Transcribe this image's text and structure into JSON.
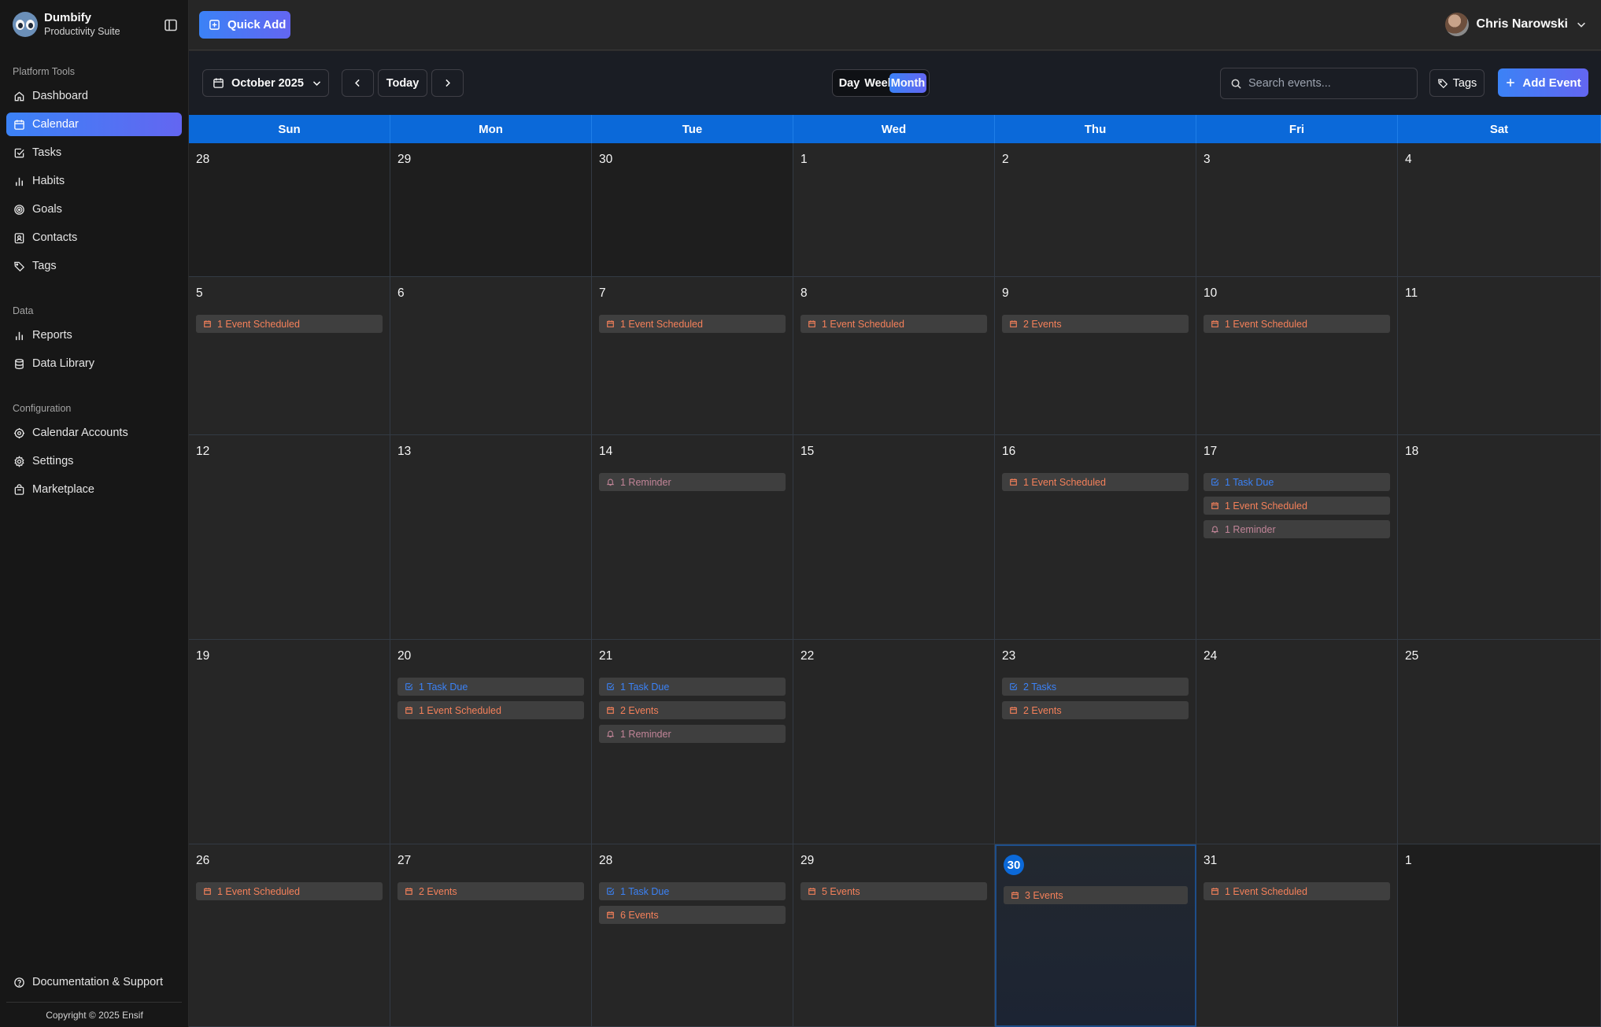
{
  "app": {
    "name": "Dumbify",
    "subtitle": "Productivity Suite"
  },
  "sidebar": {
    "sections": [
      {
        "title": "Platform Tools",
        "items": [
          {
            "label": "Dashboard",
            "icon": "home-icon"
          },
          {
            "label": "Calendar",
            "icon": "calendar-icon",
            "active": true
          },
          {
            "label": "Tasks",
            "icon": "check-square-icon"
          },
          {
            "label": "Habits",
            "icon": "bar-chart-icon"
          },
          {
            "label": "Goals",
            "icon": "target-icon"
          },
          {
            "label": "Contacts",
            "icon": "contact-icon"
          },
          {
            "label": "Tags",
            "icon": "tag-icon"
          }
        ]
      },
      {
        "title": "Data",
        "items": [
          {
            "label": "Reports",
            "icon": "bar-chart-icon"
          },
          {
            "label": "Data Library",
            "icon": "database-icon"
          }
        ]
      },
      {
        "title": "Configuration",
        "items": [
          {
            "label": "Calendar Accounts",
            "icon": "cog-icon"
          },
          {
            "label": "Settings",
            "icon": "gear-icon"
          },
          {
            "label": "Marketplace",
            "icon": "store-icon"
          }
        ]
      }
    ],
    "support_label": "Documentation & Support",
    "copyright": "Copyright © 2025 Ensif"
  },
  "header": {
    "quick_add_label": "Quick Add",
    "user_name": "Chris Narowski"
  },
  "toolbar": {
    "month_label": "October 2025",
    "today_label": "Today",
    "views": [
      "Day",
      "Week",
      "Month"
    ],
    "active_view": "Month",
    "search_placeholder": "Search events...",
    "tags_label": "Tags",
    "add_event_label": "Add Event"
  },
  "colors": {
    "accent": "#3b82f6",
    "accent_end": "#6366f1",
    "header_blue": "#0b69d9",
    "event": "#f4805a",
    "task": "#3b82f6",
    "reminder": "#c08497"
  },
  "calendar": {
    "weekdays": [
      "Sun",
      "Mon",
      "Tue",
      "Wed",
      "Thu",
      "Fri",
      "Sat"
    ],
    "weeks": [
      [
        {
          "day": "28",
          "other": true,
          "items": []
        },
        {
          "day": "29",
          "other": true,
          "items": []
        },
        {
          "day": "30",
          "other": true,
          "items": []
        },
        {
          "day": "1",
          "items": []
        },
        {
          "day": "2",
          "items": []
        },
        {
          "day": "3",
          "items": []
        },
        {
          "day": "4",
          "items": []
        }
      ],
      [
        {
          "day": "5",
          "items": [
            {
              "type": "event",
              "label": "1 Event Scheduled"
            }
          ]
        },
        {
          "day": "6",
          "items": []
        },
        {
          "day": "7",
          "items": [
            {
              "type": "event",
              "label": "1 Event Scheduled"
            }
          ]
        },
        {
          "day": "8",
          "items": [
            {
              "type": "event",
              "label": "1 Event Scheduled"
            }
          ]
        },
        {
          "day": "9",
          "items": [
            {
              "type": "event",
              "label": "2 Events"
            }
          ]
        },
        {
          "day": "10",
          "items": [
            {
              "type": "event",
              "label": "1 Event Scheduled"
            }
          ]
        },
        {
          "day": "11",
          "items": []
        }
      ],
      [
        {
          "day": "12",
          "items": []
        },
        {
          "day": "13",
          "items": []
        },
        {
          "day": "14",
          "items": [
            {
              "type": "reminder",
              "label": "1 Reminder"
            }
          ]
        },
        {
          "day": "15",
          "items": []
        },
        {
          "day": "16",
          "items": [
            {
              "type": "event",
              "label": "1 Event Scheduled"
            }
          ]
        },
        {
          "day": "17",
          "items": [
            {
              "type": "task",
              "label": "1 Task Due"
            },
            {
              "type": "event",
              "label": "1 Event Scheduled"
            },
            {
              "type": "reminder",
              "label": "1 Reminder"
            }
          ]
        },
        {
          "day": "18",
          "items": []
        }
      ],
      [
        {
          "day": "19",
          "items": []
        },
        {
          "day": "20",
          "items": [
            {
              "type": "task",
              "label": "1 Task Due"
            },
            {
              "type": "event",
              "label": "1 Event Scheduled"
            }
          ]
        },
        {
          "day": "21",
          "items": [
            {
              "type": "task",
              "label": "1 Task Due"
            },
            {
              "type": "event",
              "label": "2 Events"
            },
            {
              "type": "reminder",
              "label": "1 Reminder"
            }
          ]
        },
        {
          "day": "22",
          "items": []
        },
        {
          "day": "23",
          "items": [
            {
              "type": "task",
              "label": "2 Tasks"
            },
            {
              "type": "event",
              "label": "2 Events"
            }
          ]
        },
        {
          "day": "24",
          "items": []
        },
        {
          "day": "25",
          "items": []
        }
      ],
      [
        {
          "day": "26",
          "items": [
            {
              "type": "event",
              "label": "1 Event Scheduled"
            }
          ]
        },
        {
          "day": "27",
          "items": [
            {
              "type": "event",
              "label": "2 Events"
            }
          ]
        },
        {
          "day": "28",
          "items": [
            {
              "type": "task",
              "label": "1 Task Due"
            },
            {
              "type": "event",
              "label": "6 Events"
            }
          ]
        },
        {
          "day": "29",
          "items": [
            {
              "type": "event",
              "label": "5 Events"
            }
          ]
        },
        {
          "day": "30",
          "today": true,
          "items": [
            {
              "type": "event",
              "label": "3 Events"
            }
          ]
        },
        {
          "day": "31",
          "items": [
            {
              "type": "event",
              "label": "1 Event Scheduled"
            }
          ]
        },
        {
          "day": "1",
          "other": true,
          "items": []
        }
      ]
    ]
  }
}
